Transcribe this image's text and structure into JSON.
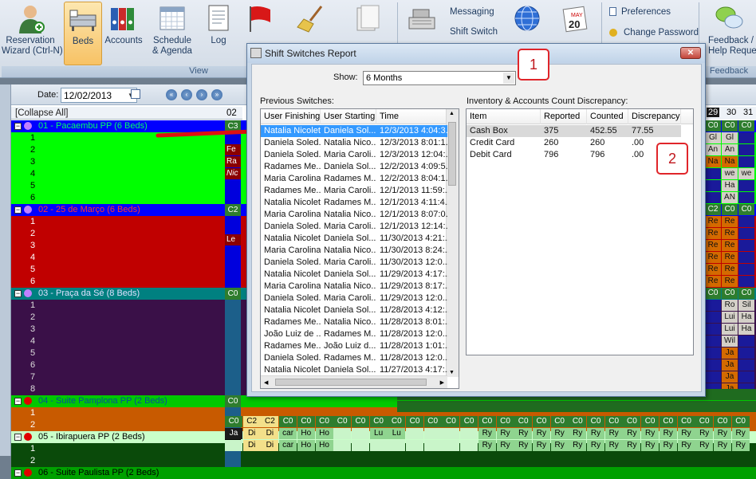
{
  "ribbon": {
    "buttons": [
      {
        "label": "Reservation\nWizard (Ctrl-N)",
        "icon": "person-add-icon"
      },
      {
        "label": "Beds",
        "icon": "beds-icon"
      },
      {
        "label": "Accounts",
        "icon": "binders-icon"
      },
      {
        "label": "Schedule\n& Agenda",
        "icon": "calendar-icon"
      },
      {
        "label": "Log",
        "icon": "log-icon"
      }
    ],
    "group_view": "View",
    "messaging": "Messaging",
    "shift_switch": "Shift Switch",
    "preferences": "Preferences",
    "change_password": "Change Password",
    "feedback_label": "Feedback /\nHelp Request",
    "group_feedback": "Feedback",
    "calendar_month": "MAY",
    "calendar_day": "20"
  },
  "toolbar": {
    "date_label": "Date:",
    "date_value": "12/02/2013"
  },
  "grid": {
    "collapse_label": "[Collapse All]",
    "day_header": "02",
    "right_days": [
      "29",
      "30",
      "31"
    ],
    "groups": [
      {
        "name": "01 - Pacaembu PP (6 Beds)",
        "beds": [
          "1",
          "2",
          "3",
          "4",
          "5",
          "6"
        ],
        "code": "C3"
      },
      {
        "name": "02 - 25 de Março (6 Beds)",
        "beds": [
          "1",
          "2",
          "3",
          "4",
          "5",
          "6"
        ],
        "code": "C2"
      },
      {
        "name": "03 - Praça da Sé (8 Beds)",
        "beds": [
          "1",
          "2",
          "3",
          "4",
          "5",
          "6",
          "7",
          "8"
        ],
        "code": "C0"
      },
      {
        "name": "04 - Suite Pamplona PP (2 Beds)",
        "beds": [
          "1",
          "2"
        ],
        "code": "C0"
      },
      {
        "name": "05 - Ibirapuera PP (2 Beds)",
        "beds": [
          "1",
          "2"
        ],
        "code": "C0"
      },
      {
        "name": "06 - Suite Paulista PP (2 Beds)",
        "beds": [],
        "code": ""
      }
    ],
    "left_cells_g1": [
      "Fe",
      "Ra",
      "Nic"
    ],
    "left_cells_g2": [
      "Le"
    ],
    "row_ibira_cells": [
      "C0",
      "C2",
      "C2",
      "C0",
      "C0",
      "C0",
      "C0",
      "C0",
      "C0",
      "C0",
      "C0",
      "C0",
      "C0",
      "C0",
      "C0",
      "C0",
      "C0",
      "C0",
      "C0",
      "C0",
      "C0",
      "C0",
      "C0",
      "C0",
      "C0",
      "C0",
      "C0",
      "C0",
      "C0"
    ],
    "row_ibira1": [
      "Ja",
      "Di",
      "Di",
      "car",
      "Ho",
      "Ho",
      "",
      "",
      "Lu",
      "Lu",
      "",
      "",
      "",
      "",
      "Ry",
      "Ry",
      "Ry",
      "Ry",
      "Ry",
      "Ry",
      "Ry",
      "Ry",
      "Ry",
      "Ry",
      "Ry",
      "Ry",
      "Ry",
      "Ry",
      "Ry"
    ],
    "row_ibira2": [
      "",
      "Di",
      "Di",
      "car",
      "Ho",
      "Ho",
      "",
      "",
      "",
      "",
      "",
      "",
      "",
      "",
      "Ry",
      "Ry",
      "Ry",
      "Ry",
      "Ry",
      "Ry",
      "Ry",
      "Ry",
      "Ry",
      "Ry",
      "Ry",
      "Ry",
      "Ry",
      "Ry",
      "Ry"
    ],
    "right_col": [
      [
        "C0",
        "C0",
        "C0"
      ],
      [
        "Gl",
        "Gl",
        ""
      ],
      [
        "An",
        "An",
        ""
      ],
      [
        "Na",
        "Na",
        ""
      ],
      [
        "",
        "we",
        "we"
      ],
      [
        "",
        "Ha",
        ""
      ],
      [
        "",
        "AN",
        ""
      ],
      [
        "C2",
        "C0",
        "C0"
      ],
      [
        "Re",
        "Re",
        ""
      ],
      [
        "Re",
        "Re",
        ""
      ],
      [
        "Re",
        "Re",
        ""
      ],
      [
        "Re",
        "Re",
        ""
      ],
      [
        "Re",
        "Re",
        ""
      ],
      [
        "Re",
        "Re",
        ""
      ],
      [
        "C0",
        "C0",
        "C0"
      ],
      [
        "",
        "Ro",
        "Sil"
      ],
      [
        "",
        "Lui",
        "Ha"
      ],
      [
        "",
        "Lui",
        "Ha"
      ],
      [
        "",
        "Wil",
        ""
      ],
      [
        "",
        "Ja",
        ""
      ],
      [
        "",
        "Ja",
        ""
      ],
      [
        "",
        "Ja",
        ""
      ],
      [
        "",
        "Ja",
        ""
      ]
    ]
  },
  "dialog": {
    "title": "Shift Switches Report",
    "show_label": "Show:",
    "show_value": "6 Months",
    "prev_label": "Previous Switches:",
    "inv_label": "Inventory & Accounts Count Discrepancy:",
    "prev_columns": [
      "User Finishing",
      "User Starting",
      "Time"
    ],
    "prev_rows": [
      [
        "Natalia Nicoletti",
        "Daniela Sol...",
        "12/3/2013 4:04:3..."
      ],
      [
        "Daniela Soled...",
        "Natalia Nico...",
        "12/3/2013 8:01:1..."
      ],
      [
        "Daniela Soled...",
        "Maria Caroli...",
        "12/3/2013 12:04:..."
      ],
      [
        "Radames Me...",
        "Daniela Sol...",
        "12/2/2013 4:09:5..."
      ],
      [
        "Maria Carolina...",
        "Radames M...",
        "12/2/2013 8:04:1..."
      ],
      [
        "Radames Me...",
        "Maria Caroli...",
        "12/1/2013 11:59:..."
      ],
      [
        "Natalia Nicoletti",
        "Radames M...",
        "12/1/2013 4:11:4..."
      ],
      [
        "Maria Carolina...",
        "Natalia Nico...",
        "12/1/2013 8:07:0..."
      ],
      [
        "Daniela Soled...",
        "Maria Caroli...",
        "12/1/2013 12:14:..."
      ],
      [
        "Natalia Nicoletti",
        "Daniela Sol...",
        "11/30/2013 4:21:..."
      ],
      [
        "Maria Carolina...",
        "Natalia Nico...",
        "11/30/2013 8:24:..."
      ],
      [
        "Daniela Soled...",
        "Maria Caroli...",
        "11/30/2013 12:0..."
      ],
      [
        "Natalia Nicoletti",
        "Daniela Sol...",
        "11/29/2013 4:17:..."
      ],
      [
        "Maria Carolina...",
        "Natalia Nico...",
        "11/29/2013 8:17:..."
      ],
      [
        "Daniela Soled...",
        "Maria Caroli...",
        "11/29/2013 12:0..."
      ],
      [
        "Natalia Nicoletti",
        "Daniela Sol...",
        "11/28/2013 4:12:..."
      ],
      [
        "Radames Me...",
        "Natalia Nico...",
        "11/28/2013 8:01:..."
      ],
      [
        "João Luiz de ...",
        "Radames M...",
        "11/28/2013 12:0..."
      ],
      [
        "Radames Me...",
        "João Luiz d...",
        "11/28/2013 1:01:..."
      ],
      [
        "Daniela Soled...",
        "Radames M...",
        "11/28/2013 12:0..."
      ],
      [
        "Natalia Nicoletti",
        "Daniela Sol...",
        "11/27/2013 4:17:..."
      ]
    ],
    "inv_columns": [
      "Item",
      "Reported",
      "Counted",
      "Discrepancy"
    ],
    "inv_rows": [
      [
        "Cash Box",
        "375",
        "452.55",
        "77.55"
      ],
      [
        "Credit Card",
        "260",
        "260",
        ".00"
      ],
      [
        "Debit Card",
        "796",
        "796",
        ".00"
      ]
    ]
  },
  "callouts": [
    "1",
    "2"
  ],
  "colors": {
    "green": "#00ff00",
    "red": "#c00000",
    "teal": "#008080",
    "purple": "#3a1048",
    "orange": "#c85a00",
    "blue": "#0000ff",
    "selected": "#3399ff",
    "callout": "#e0252a"
  }
}
